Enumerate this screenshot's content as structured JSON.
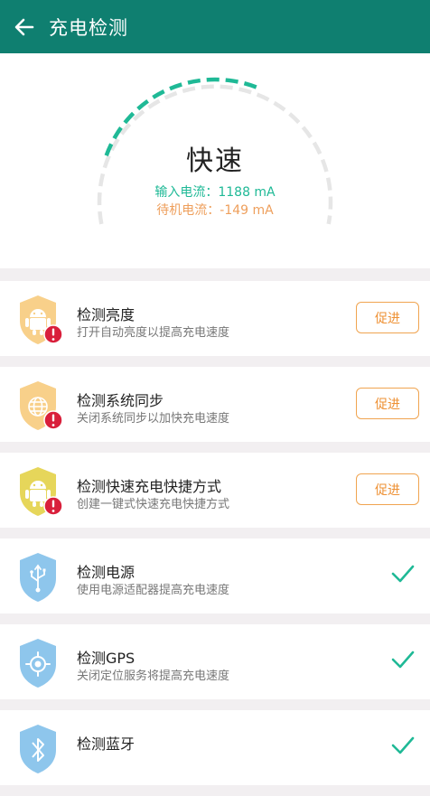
{
  "header": {
    "title": "充电检测",
    "back_icon": "arrow-left-icon"
  },
  "gauge": {
    "speed_label": "快速",
    "input_current": "输入电流：1188 mA",
    "standby_current": "待机电流：-149 mA",
    "progress_fraction": 0.42,
    "active_color": "#1fb996",
    "inactive_color": "#e6e6e6"
  },
  "checks": [
    {
      "title": "检测亮度",
      "desc": "打开自动亮度以提高充电速度",
      "action": "促进",
      "icon": "android-shield-icon",
      "shield_color": "#f8d08a",
      "status": "warning"
    },
    {
      "title": "检测系统同步",
      "desc": "关闭系统同步以加快充电速度",
      "action": "促进",
      "icon": "globe-shield-icon",
      "shield_color": "#f8d08a",
      "status": "warning"
    },
    {
      "title": "检测快速充电快捷方式",
      "desc": "创建一键式快速充电快捷方式",
      "action": "促进",
      "icon": "android-shield-icon",
      "shield_color": "#e6d65a",
      "status": "warning"
    },
    {
      "title": "检测电源",
      "desc": "使用电源适配器提高充电速度",
      "icon": "usb-shield-icon",
      "shield_color": "#8ec6ec",
      "status": "ok"
    },
    {
      "title": "检测GPS",
      "desc": "关闭定位服务将提高充电速度",
      "icon": "location-shield-icon",
      "shield_color": "#8ec6ec",
      "status": "ok"
    },
    {
      "title": "检测蓝牙",
      "desc": "",
      "icon": "bluetooth-shield-icon",
      "shield_color": "#8ec6ec",
      "status": "ok"
    }
  ]
}
